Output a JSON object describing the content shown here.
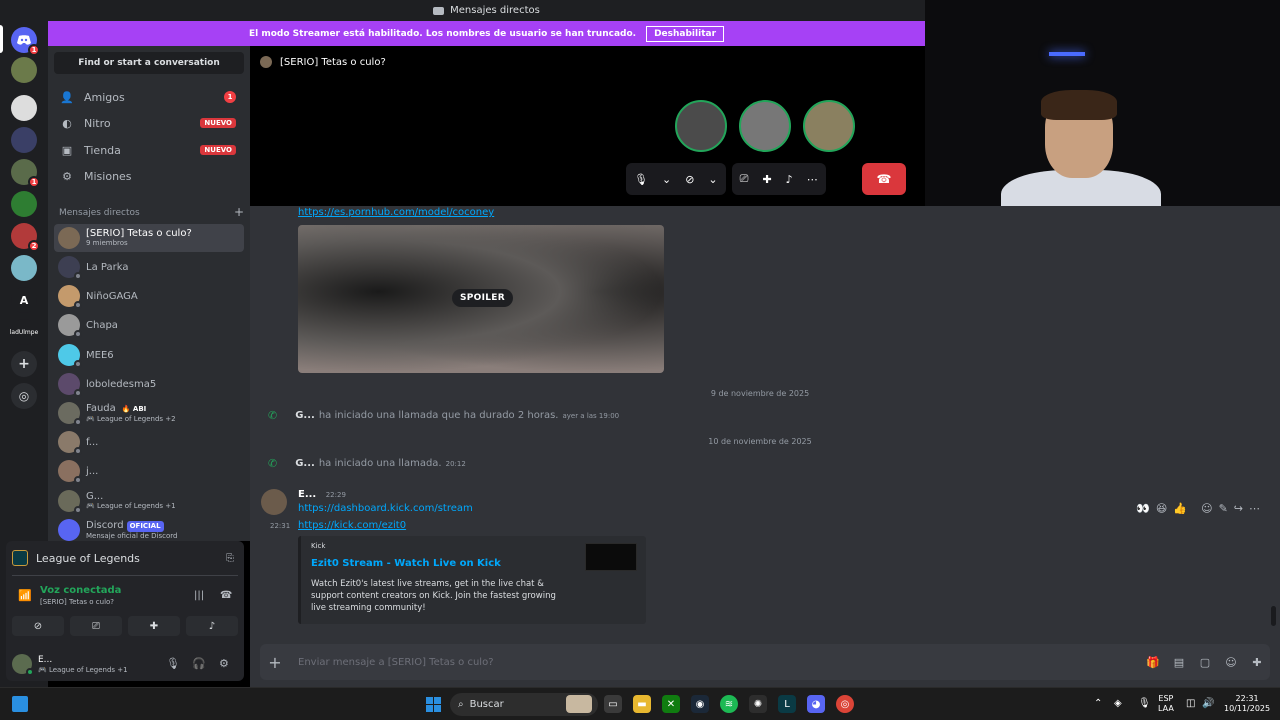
{
  "window": {
    "title": "Mensajes directos"
  },
  "streamer_banner": {
    "text": "El modo Streamer está habilitado. Los nombres de usuario se han truncado.",
    "button": "Deshabilitar"
  },
  "rail": {
    "badges": [
      "1",
      "1",
      "2"
    ],
    "label_text": "A",
    "label_text2": "ladUlmpe"
  },
  "sidebar": {
    "search": "Find or start a conversation",
    "nav": [
      {
        "label": "Amigos",
        "badge": "1"
      },
      {
        "label": "Nitro",
        "badge": "NUEVO"
      },
      {
        "label": "Tienda",
        "badge": "NUEVO"
      },
      {
        "label": "Misiones"
      }
    ],
    "dm_header": "Mensajes directos",
    "dms": [
      {
        "name": "[SERIO] Tetas o culo?",
        "sub": "9 miembros",
        "color": "#7b6955"
      },
      {
        "name": "La Parka",
        "sub": "",
        "color": "#3d3f52"
      },
      {
        "name": "NiñoGAGA",
        "sub": "",
        "color": "#c49a6c"
      },
      {
        "name": "Chapa",
        "sub": "",
        "color": "#9a9a9a"
      },
      {
        "name": "MEE6",
        "sub": "",
        "color": "#4ec9e8"
      },
      {
        "name": "loboledesma5",
        "sub": "",
        "color": "#5c4a6b"
      },
      {
        "name": "Fauda",
        "tag": "🔥 ABI",
        "sub": "League of Legends +2",
        "color": "#6b6b60"
      },
      {
        "name": "f...",
        "sub": "",
        "color": "#8a7a6a"
      },
      {
        "name": "j...",
        "sub": "",
        "color": "#8a7060"
      },
      {
        "name": "G...",
        "sub": "League of Legends +1",
        "color": "#6a6a5a"
      },
      {
        "name": "Discord",
        "tag": "OFICIAL",
        "sub": "Mensaje oficial de Discord",
        "color": "#5865f2"
      }
    ]
  },
  "voice_panel": {
    "game": "League of Legends",
    "status": "Voz conectada",
    "channel": "[SERIO] Tetas o culo?"
  },
  "user_panel": {
    "name": "E...",
    "activity": "League of Legends +1"
  },
  "call": {
    "channel": "[SERIO] Tetas o culo?",
    "participants": [
      "#4b4b4b",
      "#777",
      "#8a8060"
    ]
  },
  "chat": {
    "top_link": "https://es.pornhub.com/model/coconey",
    "spoiler": "SPOILER",
    "date1": "9 de noviembre de 2025",
    "call1": {
      "user": "G...",
      "text": "ha iniciado una llamada que ha durado 2 horas.",
      "time": "ayer a las 19:00"
    },
    "date2": "10 de noviembre de 2025",
    "call2": {
      "user": "G...",
      "text": "ha iniciado una llamada.",
      "time": "20:12"
    },
    "msg": {
      "author": "E...",
      "time": "22:29",
      "link1": "https://dashboard.kick.com/stream",
      "time2": "22:31",
      "link2": "https://kick.com/ezit0"
    },
    "embed": {
      "provider": "Kick",
      "title": "Ezit0 Stream - Watch Live on Kick",
      "description": "Watch Ezit0's latest live streams, get in the live chat & support content creators on Kick. Join the fastest growing live streaming community!"
    }
  },
  "composer": {
    "placeholder": "Enviar mensaje a [SERIO] Tetas o culo?"
  },
  "taskbar": {
    "search": "Buscar",
    "lang1": "ESP",
    "lang2": "LAA",
    "time": "22:31",
    "date": "10/11/2025"
  }
}
